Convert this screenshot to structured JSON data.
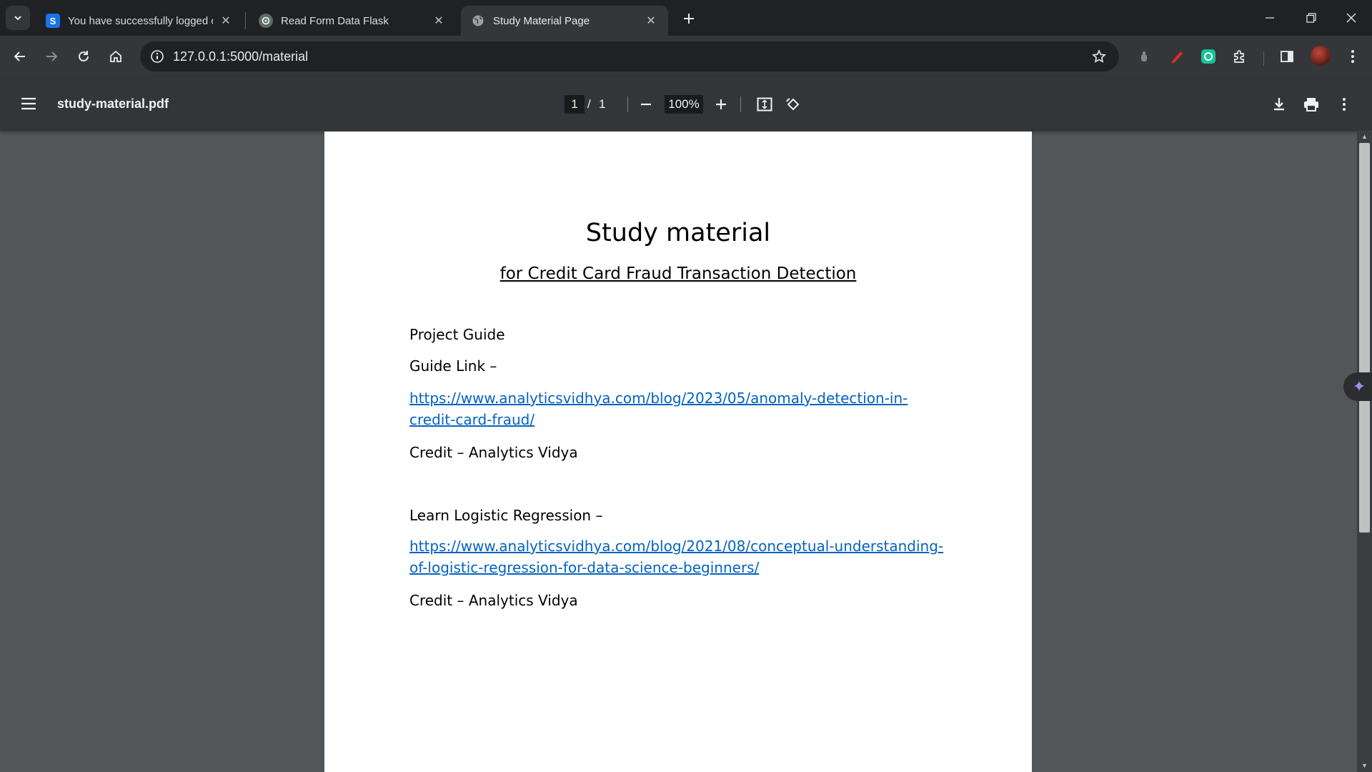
{
  "browser": {
    "tabs": [
      {
        "title": "You have successfully logged out",
        "favicon": "S",
        "favicon_color": "#1a73e8",
        "active": false
      },
      {
        "title": "Read Form Data Flask",
        "favicon": "openai-icon",
        "favicon_color": "#5d6b66",
        "active": false
      },
      {
        "title": "Study Material Page",
        "favicon": "globe-icon",
        "favicon_color": "#9aa0a6",
        "active": true
      }
    ],
    "url": "127.0.0.1:5000/material"
  },
  "pdf_viewer": {
    "filename": "study-material.pdf",
    "current_page": "1",
    "page_separator": "/",
    "total_pages": "1",
    "zoom": "100%"
  },
  "document": {
    "title": "Study material",
    "subtitle": "for Credit Card Fraud Transaction Detection",
    "project_guide": "Project Guide",
    "guide_link_label": "Guide Link –",
    "guide_link_url": "https://www.analyticsvidhya.com/blog/2023/05/anomaly-detection-in-credit-card-fraud/",
    "credit_1": "Credit – Analytics Vidya",
    "logistic_label": "Learn Logistic Regression  –",
    "logistic_url": "https://www.analyticsvidhya.com/blog/2021/08/conceptual-understanding-of-logistic-regression-for-data-science-beginners/",
    "credit_2": "Credit – Analytics Vidya",
    "link_color": "#0563c1"
  }
}
